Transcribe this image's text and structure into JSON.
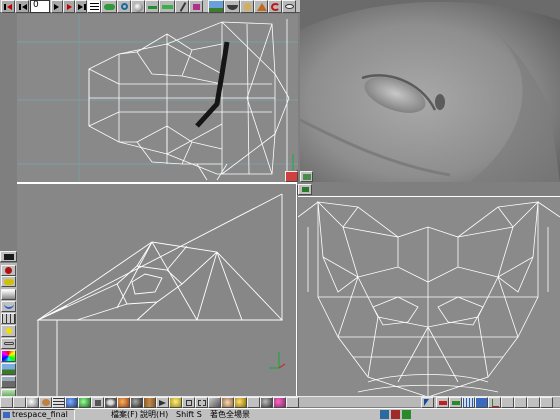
{
  "toolbar": {
    "frame_value": "0",
    "icons": [
      "rewind-start-icon",
      "step-back-icon",
      "frame-field",
      "step-forward-icon",
      "play-icon",
      "play-forward-icon",
      "spreadsheet-icon",
      "green-shape-icon",
      "magnet-icon",
      "sphere-icon",
      "arrow-tool-icon",
      "green-bar-icon",
      "pencil-icon",
      "magenta-plug-icon",
      "landscape-icon",
      "bowl-icon",
      "cylinder-icon",
      "cone-icon",
      "red-swirl-icon",
      "eye-icon",
      "up-arrow-icon",
      "window-icon"
    ]
  },
  "colors": {
    "window_bg": "#7f7f7f",
    "viewport_bg": "#8a8a8a",
    "wire": "#ffffff",
    "active_border": "#ffffff",
    "shaded_view": "#6e6e6e",
    "taskbar": "#c0c0c0"
  },
  "palette": {
    "icons": [
      "red-sphere-icon",
      "teapot-icon",
      "gradient-icon",
      "wave-icon",
      "grid-icon",
      "light-icon",
      "chain-icon",
      "color-wheel-icon",
      "landscape-icon",
      "terrain-icon",
      "green-fog-icon"
    ]
  },
  "viewports": {
    "top_left": "front-view",
    "top_right": "shaded-perspective-view",
    "bottom_left": "side-view",
    "bottom_right": "top-view"
  },
  "statusbar": {
    "task_label": "trespace_final",
    "menu_file": "檔案(F)",
    "menu_help": "說明(H)",
    "shortcut": "Shift S",
    "hint": "著色全場景"
  }
}
